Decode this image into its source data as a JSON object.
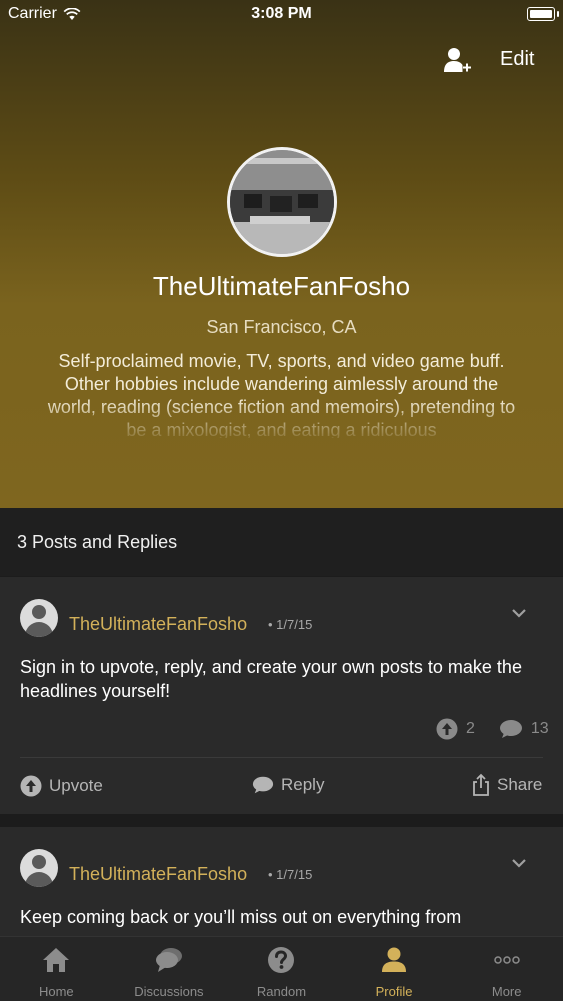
{
  "status_bar": {
    "carrier": "Carrier",
    "time": "3:08 PM"
  },
  "header": {
    "edit_label": "Edit",
    "username": "TheUltimateFanFosho",
    "location": "San Francisco, CA",
    "bio": "Self-proclaimed movie, TV, sports, and video game buff. Other hobbies include wandering aimlessly around the world, reading (science fiction and memoirs), pretending to be a mixologist, and eating a ridiculous"
  },
  "section": {
    "title": "3 Posts and Replies"
  },
  "posts": [
    {
      "author": "TheUltimateFanFosho",
      "date": "• 1/7/15",
      "body": "Sign in to upvote, reply, and create your own posts to make the headlines yourself!",
      "upvotes": "2",
      "replies": "13",
      "actions": {
        "upvote": "Upvote",
        "reply": "Reply",
        "share": "Share"
      }
    },
    {
      "author": "TheUltimateFanFosho",
      "date": "• 1/7/15",
      "body": "Keep coming back or you’ll miss out on everything from"
    }
  ],
  "tabs": [
    {
      "label": "Home",
      "icon": "home-icon"
    },
    {
      "label": "Discussions",
      "icon": "discussions-icon"
    },
    {
      "label": "Random",
      "icon": "question-icon"
    },
    {
      "label": "Profile",
      "icon": "profile-icon",
      "active": true
    },
    {
      "label": "More",
      "icon": "more-icon"
    }
  ],
  "colors": {
    "accent": "#d3b15a",
    "header_gold": "#7f661f",
    "background": "#1c1c1c",
    "card": "#2a2a2a"
  }
}
